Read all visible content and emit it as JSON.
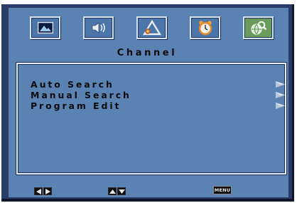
{
  "menu": {
    "title": "Channel",
    "tabs": [
      {
        "icon": "picture-icon"
      },
      {
        "icon": "sound-icon"
      },
      {
        "icon": "setup-icon"
      },
      {
        "icon": "alarm-clock-icon"
      },
      {
        "icon": "channel-globe-icon",
        "active": true
      }
    ],
    "items": [
      {
        "label": "Auto Search"
      },
      {
        "label": "Manual Search"
      },
      {
        "label": "Program Edit"
      }
    ]
  },
  "footer": {
    "menu_key_label": "MENU"
  },
  "colors": {
    "panel": "#5a83b4",
    "frame": "#2a3b68",
    "active_tab": "#6a9a5c"
  }
}
